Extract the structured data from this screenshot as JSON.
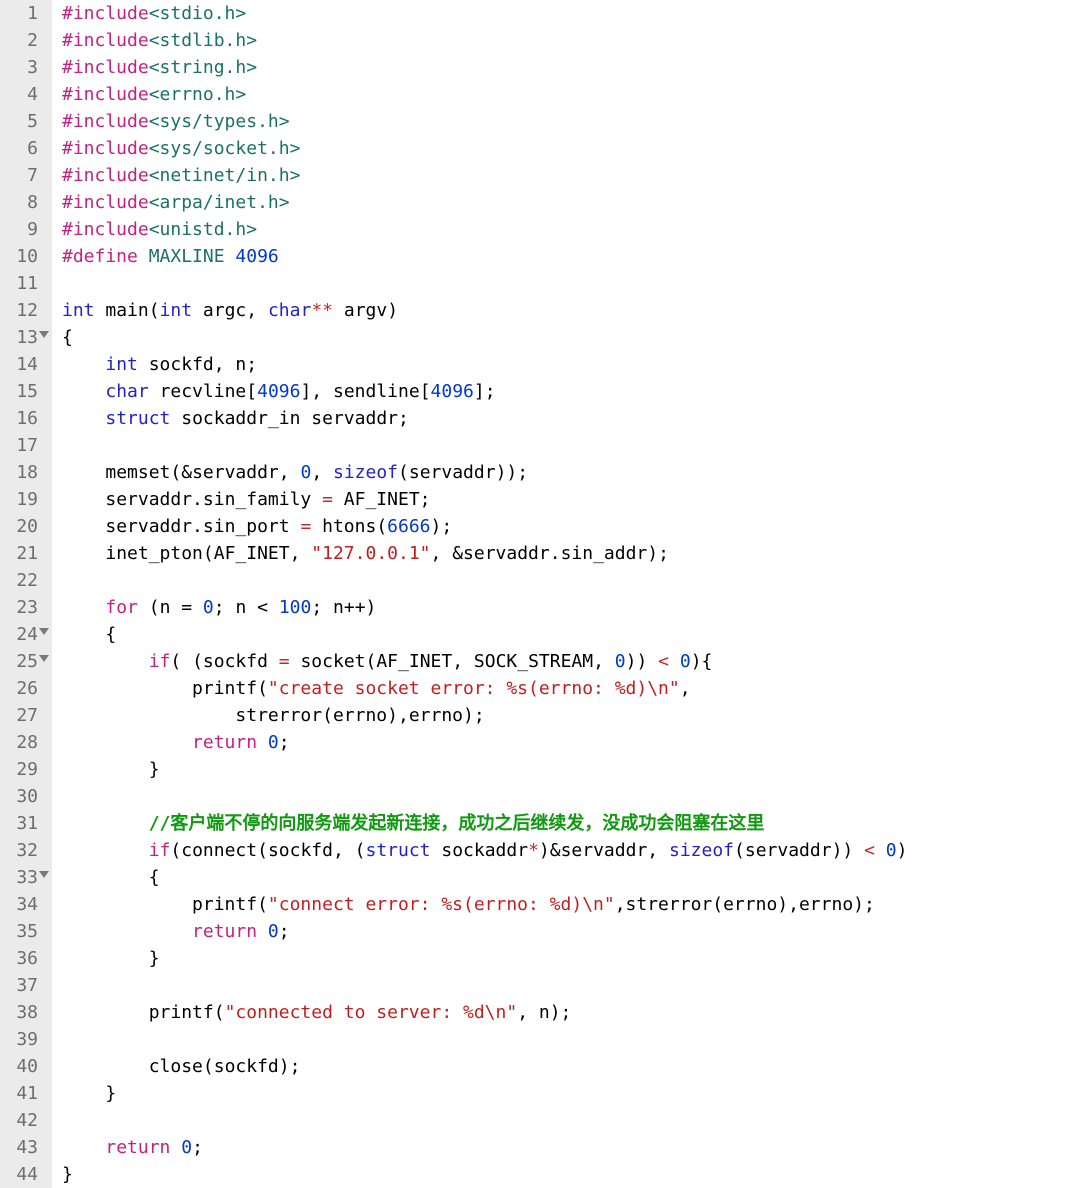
{
  "lineCount": 44,
  "foldLines": [
    13,
    24,
    25,
    33
  ],
  "code": {
    "includes": [
      {
        "dir": "#include",
        "path": "<stdio.h>"
      },
      {
        "dir": "#include",
        "path": "<stdlib.h>"
      },
      {
        "dir": "#include",
        "path": "<string.h>"
      },
      {
        "dir": "#include",
        "path": "<errno.h>"
      },
      {
        "dir": "#include",
        "path": "<sys/types.h>"
      },
      {
        "dir": "#include",
        "path": "<sys/socket.h>"
      },
      {
        "dir": "#include",
        "path": "<netinet/in.h>"
      },
      {
        "dir": "#include",
        "path": "<arpa/inet.h>"
      },
      {
        "dir": "#include",
        "path": "<unistd.h>"
      }
    ],
    "define": {
      "dir": "#define",
      "name": "MAXLINE",
      "val": "4096"
    },
    "main": {
      "ret": "int",
      "name": "main",
      "params": {
        "p1t": "int",
        "p1n": "argc",
        "p2t": "char",
        "p2n": "argv"
      }
    },
    "decl": {
      "l14": {
        "t": "int",
        "v": "sockfd, n;"
      },
      "l15": {
        "t": "char",
        "v1": "recvline",
        "sz1": "4096",
        "v2": "sendline",
        "sz2": "4096"
      },
      "l16": {
        "t": "struct",
        "name": "sockaddr_in",
        "var": "servaddr;"
      }
    },
    "l18": {
      "fn": "memset",
      "arg1": "&servaddr",
      "arg2": "0",
      "kw": "sizeof",
      "arg3": "servaddr"
    },
    "l19": {
      "lhs": "servaddr.sin_family",
      "rhs": "AF_INET"
    },
    "l20": {
      "lhs": "servaddr.sin_port",
      "fn": "htons",
      "arg": "6666"
    },
    "l21": {
      "fn": "inet_pton",
      "a1": "AF_INET",
      "a2": "\"127.0.0.1\"",
      "a3": "&servaddr.sin_addr"
    },
    "l23": {
      "kw": "for",
      "init": "n = ",
      "iv": "0",
      "cond": "n < ",
      "cv": "100",
      "iter": "n++"
    },
    "l25": {
      "kw": "if",
      "var": "sockfd",
      "fn": "socket",
      "a1": "AF_INET",
      "a2": "SOCK_STREAM",
      "a3": "0",
      "cmp": "0"
    },
    "l26": {
      "fn": "printf",
      "str": "\"create socket error: %s(errno: %d)\\n\""
    },
    "l27": {
      "fn": "strerror",
      "a1": "errno",
      "a2": "errno"
    },
    "l28": {
      "kw": "return",
      "val": "0"
    },
    "l31": {
      "comment": "//客户端不停的向服务端发起新连接，成功之后继续发，没成功会阻塞在这里"
    },
    "l32": {
      "kw": "if",
      "fn": "connect",
      "a1": "sockfd",
      "cast_kw": "struct",
      "cast": "sockaddr",
      "a2": "&servaddr",
      "skw": "sizeof",
      "a3": "servaddr",
      "cmp": "0"
    },
    "l34": {
      "fn": "printf",
      "str": "\"connect error: %s(errno: %d)\\n\"",
      "fn2": "strerror",
      "a1": "errno",
      "a2": "errno"
    },
    "l35": {
      "kw": "return",
      "val": "0"
    },
    "l38": {
      "fn": "printf",
      "str": "\"connected to server: %d\\n\"",
      "arg": "n"
    },
    "l40": {
      "fn": "close",
      "arg": "sockfd"
    },
    "l43": {
      "kw": "return",
      "val": "0"
    }
  }
}
